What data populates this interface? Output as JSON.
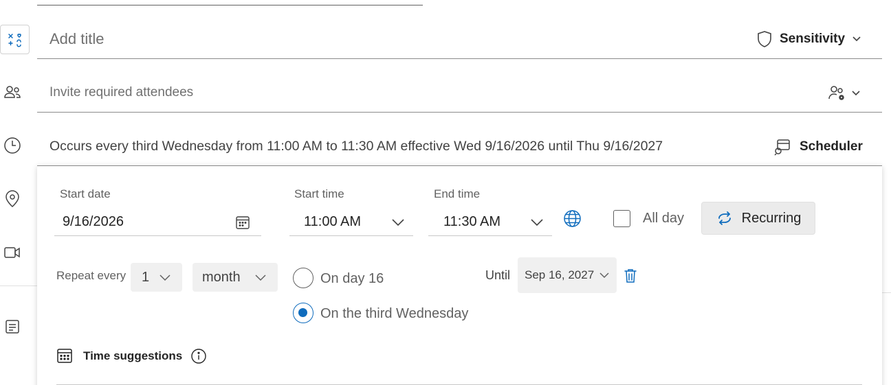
{
  "title_field": {
    "placeholder": "Add title"
  },
  "sensitivity": {
    "label": "Sensitivity"
  },
  "attendees_field": {
    "placeholder": "Invite required attendees"
  },
  "recurrence_summary": "Occurs every third Wednesday from 11:00 AM to 11:30 AM effective Wed 9/16/2026 until Thu 9/16/2027",
  "scheduler": {
    "label": "Scheduler"
  },
  "schedule": {
    "start_date_label": "Start date",
    "start_date": "9/16/2026",
    "start_time_label": "Start time",
    "start_time": "11:00 AM",
    "end_time_label": "End time",
    "end_time": "11:30 AM",
    "all_day_label": "All day",
    "recurring_label": "Recurring"
  },
  "repeat": {
    "label": "Repeat every",
    "interval": "1",
    "unit": "month",
    "option_day": "On day 16",
    "option_weekday": "On the third Wednesday",
    "until_label": "Until",
    "until_date": "Sep 16, 2027"
  },
  "time_suggestions": {
    "label": "Time suggestions"
  },
  "colors": {
    "accent": "#0f6cbd",
    "text": "#242424",
    "muted": "#616161"
  }
}
